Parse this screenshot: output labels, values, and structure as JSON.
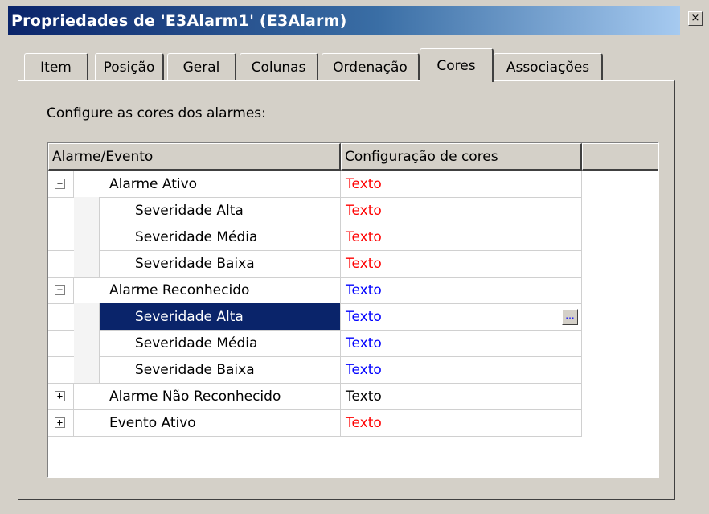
{
  "window": {
    "title": "Propriedades de 'E3Alarm1' (E3Alarm)",
    "close_symbol": "×"
  },
  "tabs": [
    {
      "label": "Item"
    },
    {
      "label": "Posição"
    },
    {
      "label": "Geral"
    },
    {
      "label": "Colunas"
    },
    {
      "label": "Ordenação"
    },
    {
      "label": "Cores",
      "active": true
    },
    {
      "label": "Associações"
    }
  ],
  "panel": {
    "instruction": "Configure as cores dos alarmes:"
  },
  "grid": {
    "columns": [
      "Alarme/Evento",
      "Configuração de cores"
    ],
    "rows": [
      {
        "expander": "−",
        "label": "Alarme Ativo",
        "value": "Texto",
        "color": "#ff0000"
      },
      {
        "label": "Severidade Alta",
        "value": "Texto",
        "color": "#ff0000"
      },
      {
        "label": "Severidade Média",
        "value": "Texto",
        "color": "#ff0000"
      },
      {
        "label": "Severidade Baixa",
        "value": "Texto",
        "color": "#ff0000"
      },
      {
        "expander": "−",
        "label": "Alarme Reconhecido",
        "value": "Texto",
        "color": "#0000ff"
      },
      {
        "label": "Severidade Alta",
        "value": "Texto",
        "color": "#0000ff",
        "selected": true,
        "button": "..."
      },
      {
        "label": "Severidade Média",
        "value": "Texto",
        "color": "#0000ff"
      },
      {
        "label": "Severidade Baixa",
        "value": "Texto",
        "color": "#0000ff"
      },
      {
        "expander": "+",
        "label": "Alarme Não Reconhecido",
        "value": "Texto",
        "color": "#000000"
      },
      {
        "expander": "+",
        "label": "Evento Ativo",
        "value": "Texto",
        "color": "#ff0000"
      }
    ]
  }
}
